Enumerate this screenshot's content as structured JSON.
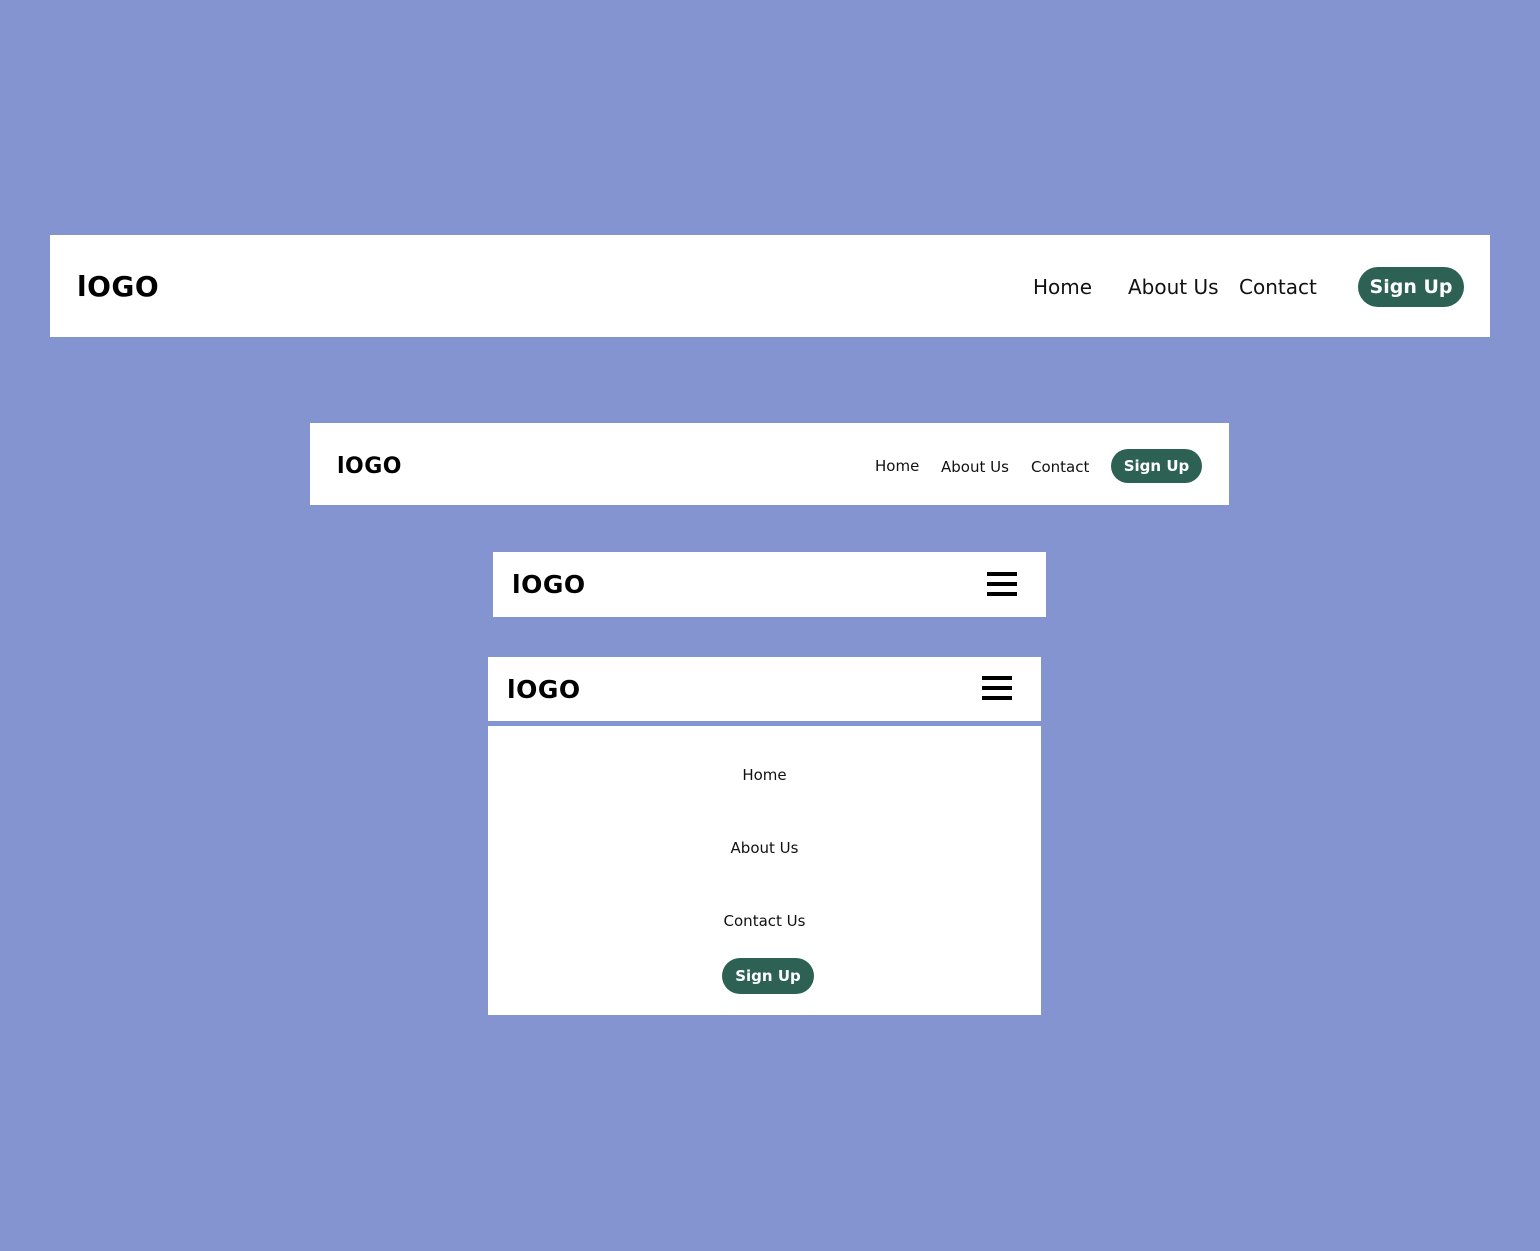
{
  "colors": {
    "background": "#8494d1",
    "bar": "#ffffff",
    "button": "#2c6153",
    "button_text": "#ffffff",
    "text": "#111111"
  },
  "navbar_desktop": {
    "logo": "lOGO",
    "links": [
      "Home",
      "About Us",
      "Contact"
    ],
    "signup_label": "Sign Up"
  },
  "navbar_tablet": {
    "logo": "lOGO",
    "links": [
      "Home",
      "About Us",
      "Contact"
    ],
    "signup_label": "Sign Up"
  },
  "navbar_mobile_collapsed": {
    "logo": "lOGO",
    "menu_icon": "hamburger-menu-icon"
  },
  "navbar_mobile_expanded": {
    "logo": "lOGO",
    "menu_icon": "hamburger-menu-icon",
    "menu_links": [
      "Home",
      "About Us",
      "Contact Us"
    ],
    "signup_label": "Sign Up"
  }
}
